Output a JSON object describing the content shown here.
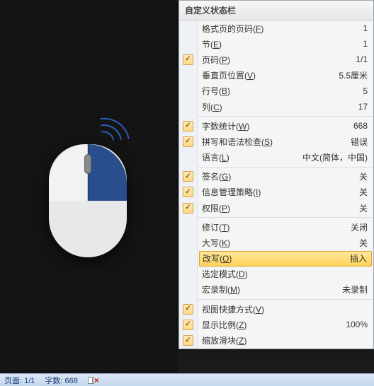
{
  "menu": {
    "title": "自定义状态栏",
    "groups": [
      [
        {
          "id": "page-of-format",
          "label": "格式页的页码",
          "accel": "F",
          "value": "1",
          "checked": false
        },
        {
          "id": "section",
          "label": "节",
          "accel": "E",
          "value": "1",
          "checked": false
        },
        {
          "id": "page-number",
          "label": "页码",
          "accel": "P",
          "value": "1/1",
          "checked": true
        },
        {
          "id": "vertical-position",
          "label": "垂直页位置",
          "accel": "V",
          "value": "5.5厘米",
          "checked": false
        },
        {
          "id": "line-number",
          "label": "行号",
          "accel": "B",
          "value": "5",
          "checked": false
        },
        {
          "id": "column",
          "label": "列",
          "accel": "C",
          "value": "17",
          "checked": false
        }
      ],
      [
        {
          "id": "word-count",
          "label": "字数统计",
          "accel": "W",
          "value": "668",
          "checked": true
        },
        {
          "id": "spell-grammar",
          "label": "拼写和语法检查",
          "accel": "S",
          "value": "错误",
          "checked": true
        },
        {
          "id": "language",
          "label": "语言",
          "accel": "L",
          "value": "中文(简体，中国)",
          "checked": false
        }
      ],
      [
        {
          "id": "signature",
          "label": "签名",
          "accel": "G",
          "value": "关",
          "checked": true
        },
        {
          "id": "info-policy",
          "label": "信息管理策略",
          "accel": "I",
          "value": "关",
          "checked": true
        },
        {
          "id": "permissions",
          "label": "权限",
          "accel": "P",
          "value": "关",
          "checked": true
        }
      ],
      [
        {
          "id": "revisions",
          "label": "修订",
          "accel": "T",
          "value": "关闭",
          "checked": false
        },
        {
          "id": "caps-lock",
          "label": "大写",
          "accel": "K",
          "value": "关",
          "checked": false
        },
        {
          "id": "overtype",
          "label": "改写",
          "accel": "O",
          "value": "插入",
          "checked": false,
          "highlight": true
        },
        {
          "id": "selection-mode",
          "label": "选定模式",
          "accel": "D",
          "value": "",
          "checked": false
        },
        {
          "id": "macro-record",
          "label": "宏录制",
          "accel": "M",
          "value": "未录制",
          "checked": false
        }
      ],
      [
        {
          "id": "view-shortcut",
          "label": "视图快捷方式",
          "accel": "V",
          "value": "",
          "checked": true
        },
        {
          "id": "zoom",
          "label": "显示比例",
          "accel": "Z",
          "value": "100%",
          "checked": true
        },
        {
          "id": "zoom-slider",
          "label": "缩放滑块",
          "accel": "Z",
          "value": "",
          "checked": true
        }
      ]
    ]
  },
  "status": {
    "page": "页面: 1/1",
    "words": "字数: 668"
  },
  "watermark": ""
}
